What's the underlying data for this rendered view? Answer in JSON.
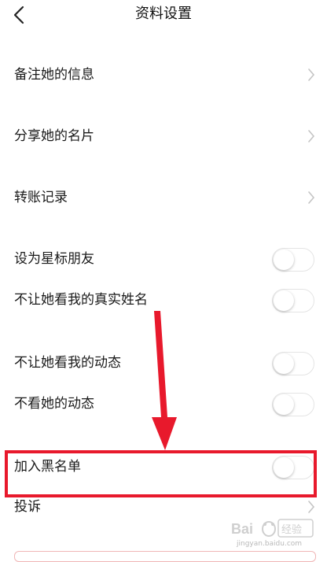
{
  "header": {
    "title": "资料设置",
    "back_icon": "chevron-left-icon"
  },
  "rows": {
    "remark": "备注她的信息",
    "share_card": "分享她的名片",
    "transfer_records": "转账记录",
    "star_friend": "设为星标朋友",
    "hide_real_name": "不让她看我的真实姓名",
    "hide_moments": "不让她看我的动态",
    "mute_moments": "不看她的动态",
    "blacklist": "加入黑名单",
    "report": "投诉"
  },
  "toggles": {
    "star_friend": false,
    "hide_real_name": false,
    "hide_moments": false,
    "mute_moments": false,
    "blacklist": false
  },
  "annotation": {
    "color": "#e8192c"
  },
  "watermark": {
    "text": "jingyan.baidu.com"
  }
}
